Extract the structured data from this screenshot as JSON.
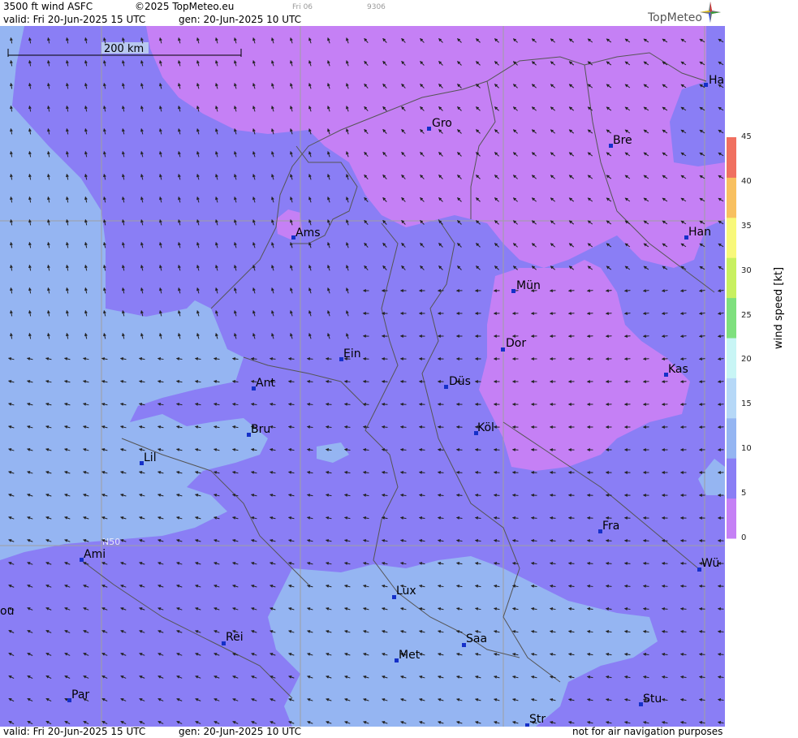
{
  "header": {
    "title": "3500 ft wind ASFC",
    "copyright": "©2025 TopMeteo.eu",
    "run_label": "Fri 06",
    "run_code": "9306",
    "valid": "valid:  Fri  20-Jun-2025  15 UTC",
    "gen": "gen: 20-Jun-2025 10 UTC",
    "brand": "TopMeteo"
  },
  "footer": {
    "valid": "valid:  Fri  20-Jun-2025  15 UTC",
    "gen": "gen: 20-Jun-2025 10 UTC",
    "disclaimer": "not for air navigation purposes"
  },
  "map": {
    "scale_label": "200 km",
    "lat_label": "N50",
    "cities": [
      "Ha",
      "Gro",
      "Bre",
      "Ams",
      "Han",
      "Mün",
      "Dor",
      "Ein",
      "Kas",
      "Düs",
      "Ant",
      "Köl",
      "Bru",
      "Lil",
      "Fra",
      "Ami",
      "Wü",
      "Lux",
      "ou",
      "Rei",
      "Saa",
      "Met",
      "Par",
      "Stu",
      "Str"
    ],
    "colors": {
      "calm": "#c580f5",
      "light": "#8a7ef5",
      "moderate": "#95b5f2",
      "city_marker": "#1530c8"
    }
  },
  "legend": {
    "title": "wind speed [kt]",
    "ticks": [
      "45",
      "40",
      "35",
      "30",
      "25",
      "20",
      "15",
      "10",
      "5",
      "0"
    ],
    "colors": [
      "#c580f5",
      "#8a7ef5",
      "#95b5f2",
      "#b6d8f7",
      "#c8f5f5",
      "#7ee07e",
      "#c8f060",
      "#f8f87a",
      "#f8c060",
      "#f07060"
    ]
  }
}
